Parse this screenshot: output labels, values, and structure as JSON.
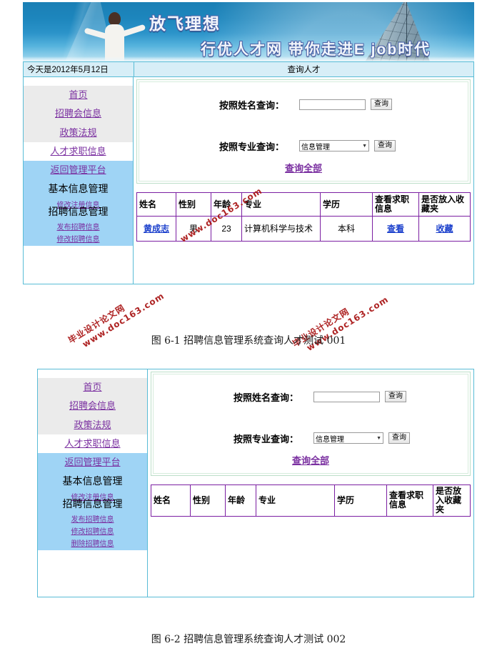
{
  "page": {
    "watermark": {
      "line1": "毕业设计论文网",
      "line2": "www.doc163.com"
    }
  },
  "figures": [
    {
      "id": "fig-6-1",
      "caption": "图 6-1  招聘信息管理系统查询人才测试 001",
      "banner": {
        "title_line1": "放飞理想",
        "title_line2": "行优人才网  带你走进E job时代"
      },
      "topbar": {
        "date": "今天是2012年5月12日",
        "title": "查询人才"
      },
      "sidebar": {
        "group_gray": [
          {
            "label": "首页",
            "type": "link"
          },
          {
            "label": "招聘会信息",
            "type": "link"
          },
          {
            "label": "政策法规",
            "type": "link"
          }
        ],
        "group_white": [
          {
            "label": "人才求职信息",
            "type": "link"
          }
        ],
        "group_blue": [
          {
            "label": "返回管理平台",
            "type": "link"
          },
          {
            "label": "基本信息管理",
            "type": "text"
          },
          {
            "label": "修改注册信息",
            "type": "link-small"
          },
          {
            "label": "招聘信息管理",
            "type": "text"
          },
          {
            "label": "发布招聘信息",
            "type": "link-small"
          },
          {
            "label": "修改招聘信息",
            "type": "link-small"
          }
        ]
      },
      "form": {
        "name_label": "按照姓名查询：",
        "name_value": "",
        "name_placeholder": "",
        "name_button": "查询",
        "major_label": "按照专业查询：",
        "major_selected": "信息管理",
        "major_options": [
          "信息管理"
        ],
        "major_button": "查询",
        "query_all": "查询全部"
      },
      "table": {
        "headers": [
          "姓名",
          "性别",
          "年龄",
          "专业",
          "学历",
          "查看求职信息",
          "是否放入收藏夹"
        ],
        "rows": [
          {
            "name": "黄成志",
            "gender": "男",
            "age": "23",
            "major": "计算机科学与技术",
            "degree": "本科",
            "view": "查看",
            "favorite": "收藏"
          }
        ]
      }
    },
    {
      "id": "fig-6-2",
      "caption": "图 6-2  招聘信息管理系统查询人才测试 002",
      "sidebar": {
        "group_gray": [
          {
            "label": "首页",
            "type": "link"
          },
          {
            "label": "招聘会信息",
            "type": "link"
          },
          {
            "label": "政策法规",
            "type": "link"
          }
        ],
        "group_white": [
          {
            "label": "人才求职信息",
            "type": "link"
          }
        ],
        "group_blue": [
          {
            "label": "返回管理平台",
            "type": "link"
          },
          {
            "label": "基本信息管理",
            "type": "text"
          },
          {
            "label": "修改注册信息",
            "type": "link-small"
          },
          {
            "label": "招聘信息管理",
            "type": "text"
          },
          {
            "label": "发布招聘信息",
            "type": "link-small"
          },
          {
            "label": "修改招聘信息",
            "type": "link-small"
          },
          {
            "label": "删除招聘信息",
            "type": "link-small"
          }
        ]
      },
      "form": {
        "name_label": "按照姓名查询：",
        "name_value": "",
        "name_placeholder": "",
        "name_button": "查询",
        "major_label": "按照专业查询：",
        "major_selected": "信息管理",
        "major_options": [
          "信息管理"
        ],
        "major_button": "查询",
        "query_all": "查询全部"
      },
      "table": {
        "headers": [
          "姓名",
          "性别",
          "年龄",
          "专业",
          "学历",
          "查看求职信息",
          "是否放入收藏夹"
        ],
        "rows": []
      }
    }
  ]
}
